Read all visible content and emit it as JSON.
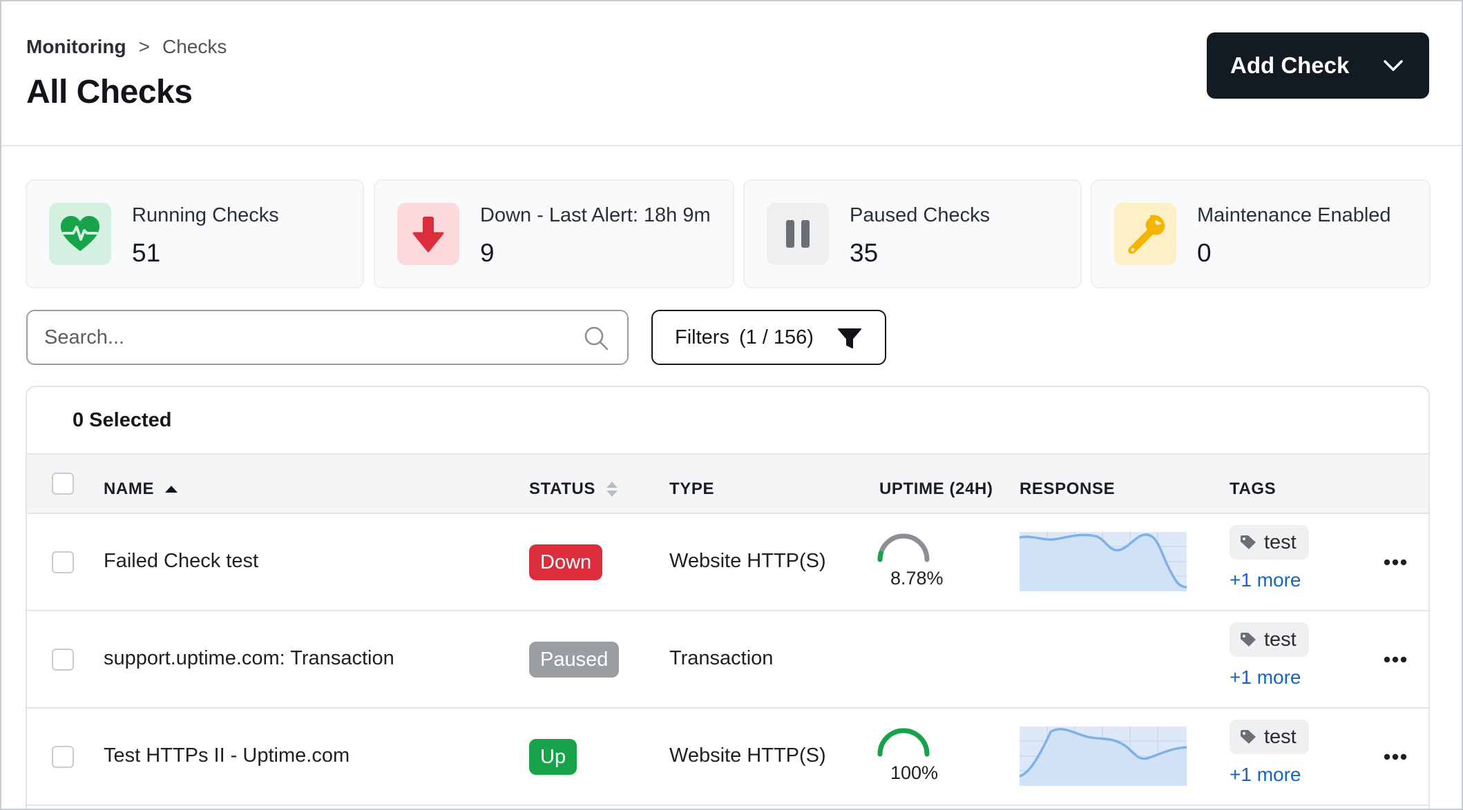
{
  "header": {
    "breadcrumb_root": "Monitoring",
    "breadcrumb_sep": ">",
    "breadcrumb_current": "Checks",
    "title": "All Checks",
    "add_button_label": "Add Check"
  },
  "stats": [
    {
      "label": "Running Checks",
      "value": "51",
      "icon": "heartbeat-icon",
      "icon_bg": "#d4f0e0",
      "icon_color": "#17a34a"
    },
    {
      "label": "Down - Last Alert: 18h 9m",
      "value": "9",
      "icon": "arrow-down-icon",
      "icon_bg": "#fbd9dc",
      "icon_color": "#dc2d3c"
    },
    {
      "label": "Paused Checks",
      "value": "35",
      "icon": "pause-icon",
      "icon_bg": "#eeeff1",
      "icon_color": "#6b6f75"
    },
    {
      "label": "Maintenance Enabled",
      "value": "0",
      "icon": "wrench-icon",
      "icon_bg": "#fdf0c7",
      "icon_color": "#f4b400"
    }
  ],
  "search": {
    "placeholder": "Search..."
  },
  "filters": {
    "label": "Filters",
    "count": "(1 / 156)"
  },
  "table": {
    "selected_label": "0 Selected",
    "columns": [
      "NAME",
      "STATUS",
      "TYPE",
      "UPTIME (24H)",
      "RESPONSE",
      "TAGS"
    ],
    "rows": [
      {
        "name": "Failed Check test",
        "status": "Down",
        "status_kind": "down",
        "type": "Website HTTP(S)",
        "uptime": "8.78%",
        "uptime_fraction": 0.0878,
        "tag": "test",
        "more": "+1 more"
      },
      {
        "name": "support.uptime.com: Transaction",
        "status": "Paused",
        "status_kind": "paused",
        "type": "Transaction",
        "uptime": "",
        "tag": "test",
        "more": "+1 more"
      },
      {
        "name": "Test HTTPs II - Uptime.com",
        "status": "Up",
        "status_kind": "up",
        "type": "Website HTTP(S)",
        "uptime": "100%",
        "uptime_fraction": 1.0,
        "tag": "test",
        "more": "+1 more"
      }
    ]
  },
  "colors": {
    "accent_dark": "#121a22",
    "status_down": "#dc2d3c",
    "status_paused": "#9a9ea3",
    "status_up": "#17a34a",
    "link": "#1665c0"
  }
}
